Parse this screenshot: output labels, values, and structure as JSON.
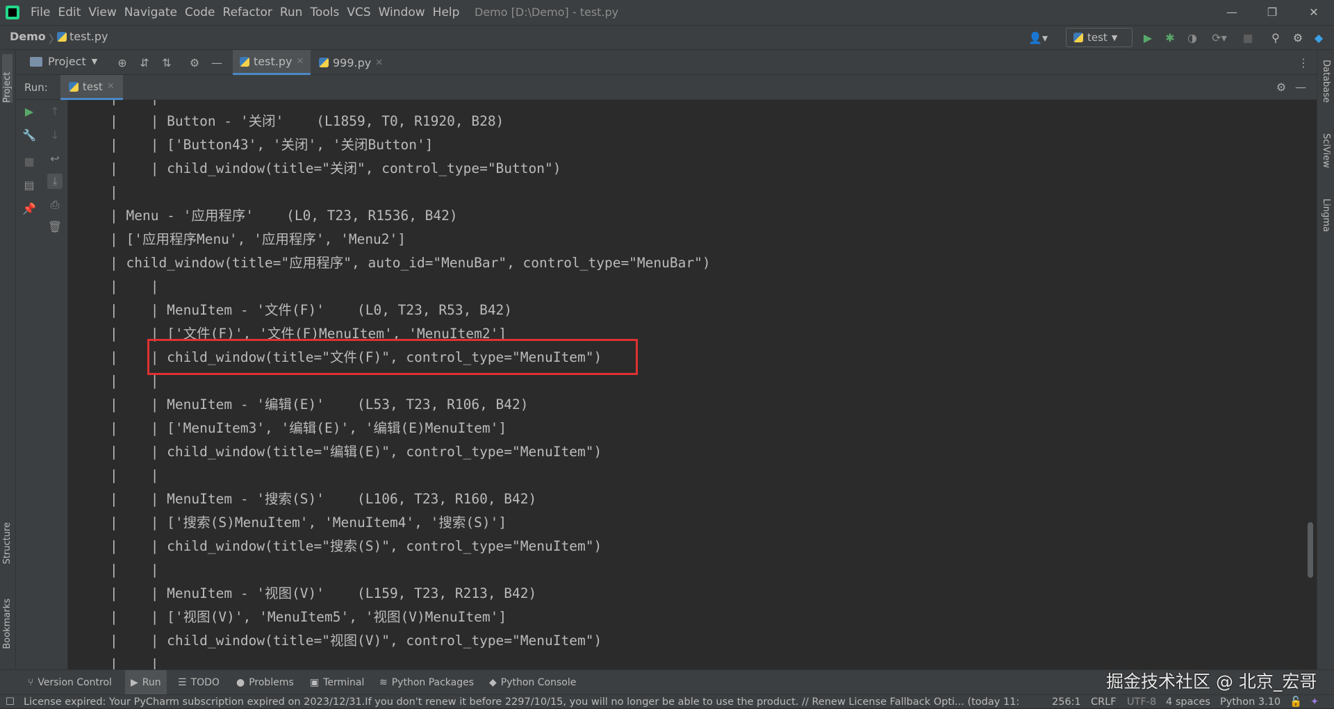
{
  "window": {
    "menu": [
      "File",
      "Edit",
      "View",
      "Navigate",
      "Code",
      "Refactor",
      "Run",
      "Tools",
      "VCS",
      "Window",
      "Help"
    ],
    "title": "Demo [D:\\Demo] - test.py"
  },
  "navbar": {
    "project": "Demo",
    "file": "test.py",
    "run_config": "test"
  },
  "left_stripe": {
    "project": "Project",
    "structure": "Structure",
    "bookmarks": "Bookmarks"
  },
  "right_stripe": {
    "database": "Database",
    "sciview": "SciView",
    "lingma": "Lingma"
  },
  "project_panel": {
    "label": "Project"
  },
  "editor_tabs": [
    {
      "label": "test.py",
      "active": true
    },
    {
      "label": "999.py",
      "active": false
    }
  ],
  "run": {
    "label": "Run:",
    "tab": "test"
  },
  "console_lines": [
    "|    |",
    "|    | Button - '关闭'    (L1859, T0, R1920, B28)",
    "|    | ['Button43', '关闭', '关闭Button']",
    "|    | child_window(title=\"关闭\", control_type=\"Button\")",
    "|",
    "| Menu - '应用程序'    (L0, T23, R1536, B42)",
    "| ['应用程序Menu', '应用程序', 'Menu2']",
    "| child_window(title=\"应用程序\", auto_id=\"MenuBar\", control_type=\"MenuBar\")",
    "|    |",
    "|    | MenuItem - '文件(F)'    (L0, T23, R53, B42)",
    "|    | ['文件(F)', '文件(F)MenuItem', 'MenuItem2']",
    "|    | child_window(title=\"文件(F)\", control_type=\"MenuItem\")",
    "|    |",
    "|    | MenuItem - '编辑(E)'    (L53, T23, R106, B42)",
    "|    | ['MenuItem3', '编辑(E)', '编辑(E)MenuItem']",
    "|    | child_window(title=\"编辑(E)\", control_type=\"MenuItem\")",
    "|    |",
    "|    | MenuItem - '搜索(S)'    (L106, T23, R160, B42)",
    "|    | ['搜索(S)MenuItem', 'MenuItem4', '搜索(S)']",
    "|    | child_window(title=\"搜索(S)\", control_type=\"MenuItem\")",
    "|    |",
    "|    | MenuItem - '视图(V)'    (L159, T23, R213, B42)",
    "|    | ['视图(V)', 'MenuItem5', '视图(V)MenuItem']",
    "|    | child_window(title=\"视图(V)\", control_type=\"MenuItem\")",
    "|    |"
  ],
  "bottom_tabs": [
    "Version Control",
    "Run",
    "TODO",
    "Problems",
    "Terminal",
    "Python Packages",
    "Python Console"
  ],
  "watermark": "掘金技术社区 @ 北京_宏哥",
  "status": {
    "message": "License expired: Your PyCharm subscription expired on 2023/12/31.If you don't renew it before 2297/10/15, you will no longer be able to use the product. // Renew License    Fallback Opti... (today 11:",
    "position": "256:1",
    "line_sep": "CRLF",
    "encoding": "UTF-8",
    "indent": "4 spaces",
    "interpreter": "Python 3.10"
  },
  "colors": {
    "accent": "#4a88c7",
    "highlight_box": "#e03131",
    "run_green": "#59a869"
  }
}
